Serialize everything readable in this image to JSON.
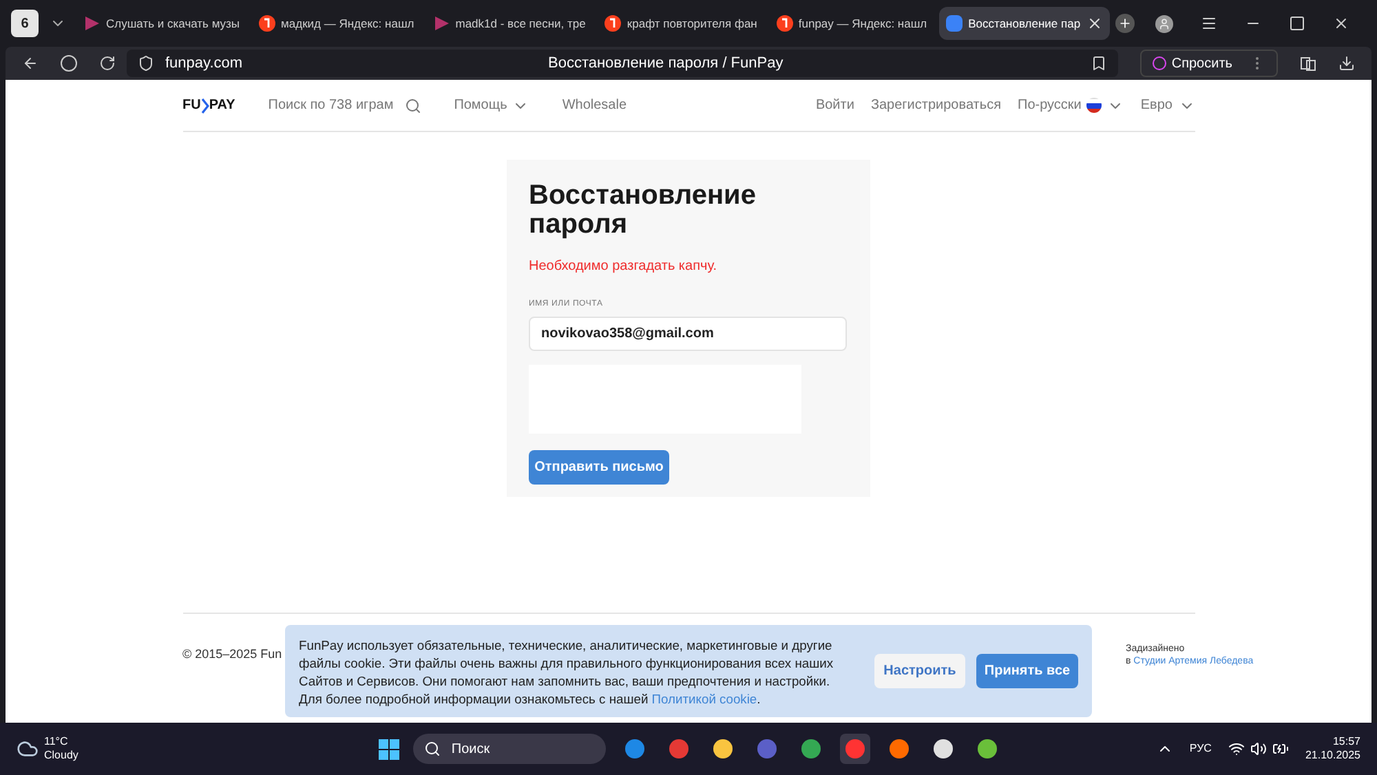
{
  "browser": {
    "tab_count": "6",
    "tabs": [
      {
        "kind": "music",
        "title": "Слушать и скачать музы",
        "selected": false
      },
      {
        "kind": "yandex",
        "title": "мадкид — Яндекс: нашл",
        "selected": false
      },
      {
        "kind": "music",
        "title": "madk1d - все песни, тре",
        "selected": false
      },
      {
        "kind": "yandex",
        "title": "крафт повторителя фан",
        "selected": false
      },
      {
        "kind": "yandex",
        "title": "funpay — Яндекс: нашл",
        "selected": false
      },
      {
        "kind": "funpay",
        "title": "Восстановление пар",
        "selected": true
      }
    ],
    "address": "funpay.com",
    "page_title": "Восстановление пароля / FunPay",
    "ask_button": "Спросить"
  },
  "header": {
    "logo": [
      "FU",
      "PAY"
    ],
    "search": "Поиск по 738 играм",
    "help": "Помощь",
    "wholesale": "Wholesale",
    "login": "Войти",
    "register": "Зарегистрироваться",
    "language": "По-русски",
    "currency": "Евро"
  },
  "form": {
    "title": "Восстановление пароля",
    "error": "Необходимо разгадать капчу.",
    "field_label": "ИМЯ ИЛИ ПОЧТА",
    "field_value": "novikovao358@gmail.com",
    "submit": "Отправить письмо"
  },
  "footer": {
    "copyright": "© 2015–2025 Fun",
    "designed": "Задизайнено",
    "designed_in": "в",
    "studio_link": "Студии Артемия Лебедева"
  },
  "cookie_banner": {
    "text": "FunPay использует обязательные, технические, аналитические, маркетинговые и другие файлы cookie. Эти файлы очень важны для правильного функционирования всех наших Сайтов и Сервисов. Они помогают нам запомнить вас, ваши предпочтения и настройки. Для более подробной информации ознакомьтесь с нашей",
    "link": "Политикой cookie",
    "text_end": ".",
    "settings_button": "Настроить",
    "accept_button": "Принять все"
  },
  "taskbar": {
    "temperature": "11°C",
    "weather": "Cloudy",
    "search": "Поиск",
    "language": "РУС",
    "time": "15:57",
    "date": "21.10.2025",
    "apps": [
      {
        "color": "#1e88e5",
        "selected": false
      },
      {
        "color": "#e53935",
        "selected": false
      },
      {
        "color": "#f9c440",
        "selected": false
      },
      {
        "color": "#5b5fc7",
        "selected": false
      },
      {
        "color": "#34a853",
        "selected": false
      },
      {
        "color": "#ff3333",
        "selected": true
      },
      {
        "color": "#ff6a00",
        "selected": false
      },
      {
        "color": "#e0e0e0",
        "selected": false
      },
      {
        "color": "#6abf3a",
        "selected": false
      }
    ]
  }
}
